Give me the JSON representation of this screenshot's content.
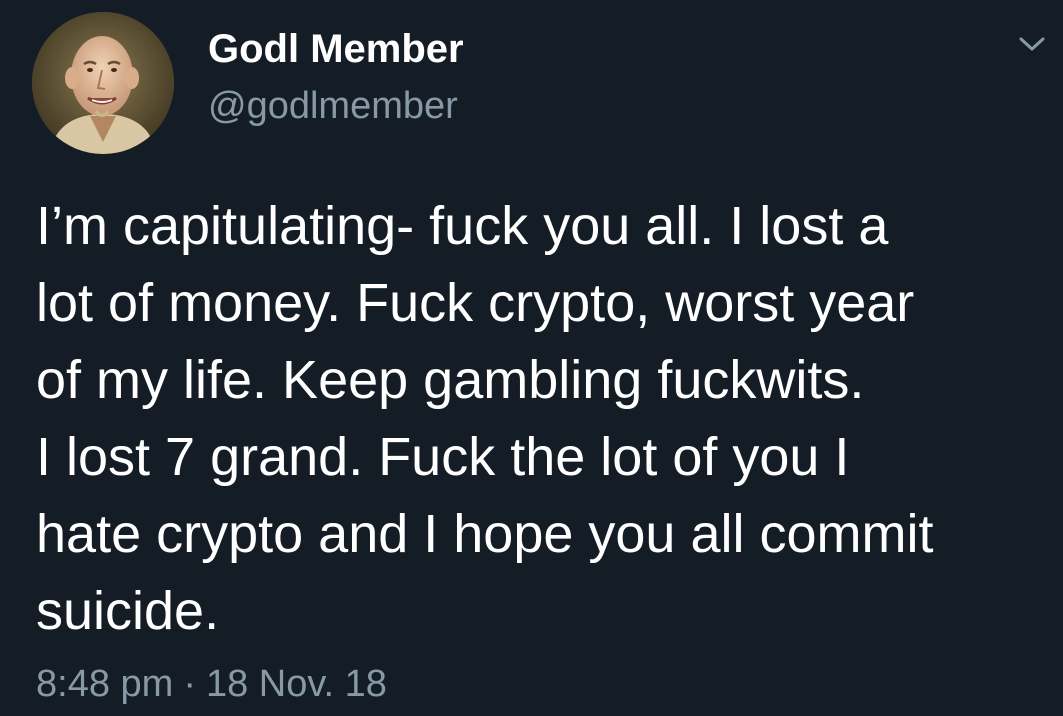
{
  "tweet": {
    "display_name": "Godl Member",
    "handle": "@godlmember",
    "text_lines": [
      "I’m capitulating- fuck you all. I lost a",
      "lot of money. Fuck crypto, worst year",
      "of my life. Keep gambling fuckwits.",
      "I lost 7 grand. Fuck the lot of you I",
      "hate crypto and I hope you all commit",
      "suicide."
    ],
    "time": "8:48 pm",
    "separator": "·",
    "date": "18 Nov. 18"
  },
  "icons": {
    "caret": "chevron-down-icon",
    "avatar": "avatar"
  },
  "colors": {
    "background": "#141d26",
    "primary_text": "#ffffff",
    "secondary_text": "#8899a6"
  }
}
